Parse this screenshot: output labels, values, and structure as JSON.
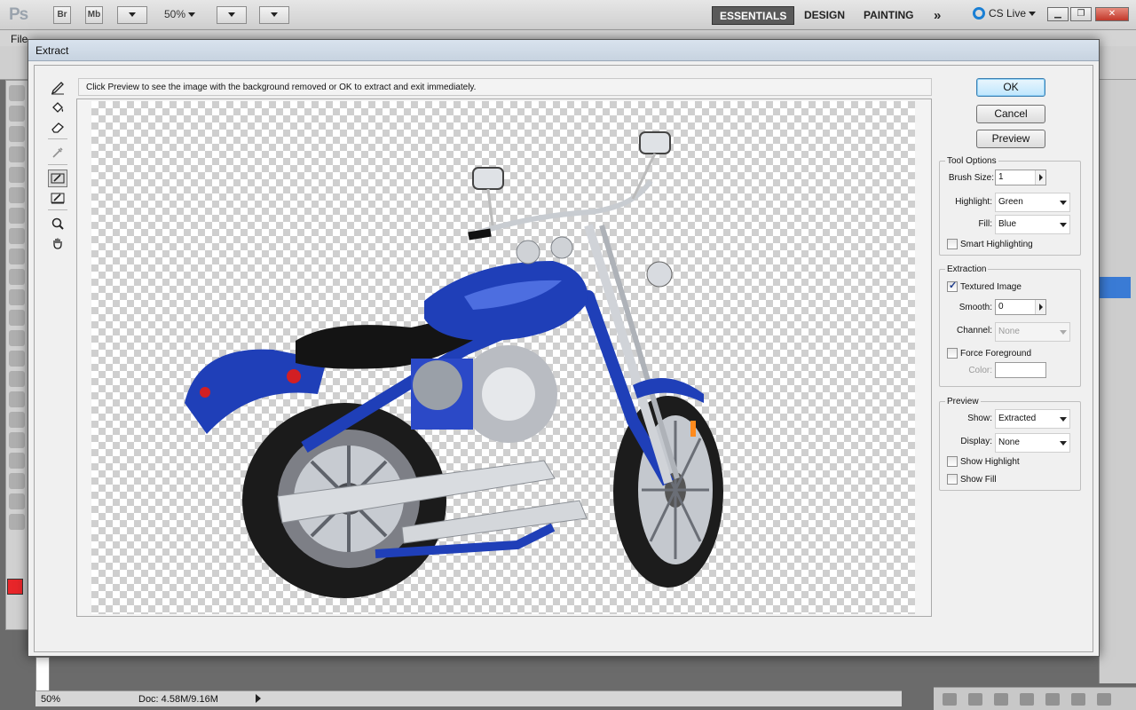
{
  "app": {
    "logo": "Ps",
    "bridge_label": "Br",
    "minibridge_label": "Mb",
    "zoom_level": "50%",
    "workspaces": {
      "essentials": "ESSENTIALS",
      "design": "DESIGN",
      "painting": "PAINTING",
      "more": "»"
    },
    "cs_live": "CS Live",
    "menu_first": "File"
  },
  "dialog": {
    "title": "Extract",
    "hint": "Click Preview to see the image with the background removed or OK to extract and exit immediately.",
    "buttons": {
      "ok": "OK",
      "cancel": "Cancel",
      "preview": "Preview"
    },
    "tool_options": {
      "legend": "Tool Options",
      "brush_size_label": "Brush Size:",
      "brush_size_value": "1",
      "highlight_label": "Highlight:",
      "highlight_value": "Green",
      "fill_label": "Fill:",
      "fill_value": "Blue",
      "smart_highlighting": "Smart Highlighting"
    },
    "extraction": {
      "legend": "Extraction",
      "textured_image": "Textured Image",
      "smooth_label": "Smooth:",
      "smooth_value": "0",
      "channel_label": "Channel:",
      "channel_value": "None",
      "force_foreground": "Force Foreground",
      "color_label": "Color:"
    },
    "preview": {
      "legend": "Preview",
      "show_label": "Show:",
      "show_value": "Extracted",
      "display_label": "Display:",
      "display_value": "None",
      "show_highlight": "Show Highlight",
      "show_fill": "Show Fill"
    }
  },
  "status": {
    "zoom": "50%",
    "doc": "Doc: 4.58M/9.16M"
  },
  "colors": {
    "motorcycle_body": "#1f3fb8",
    "foreground_swatch": "#e8262a",
    "ok_button": "#bee6fd"
  }
}
